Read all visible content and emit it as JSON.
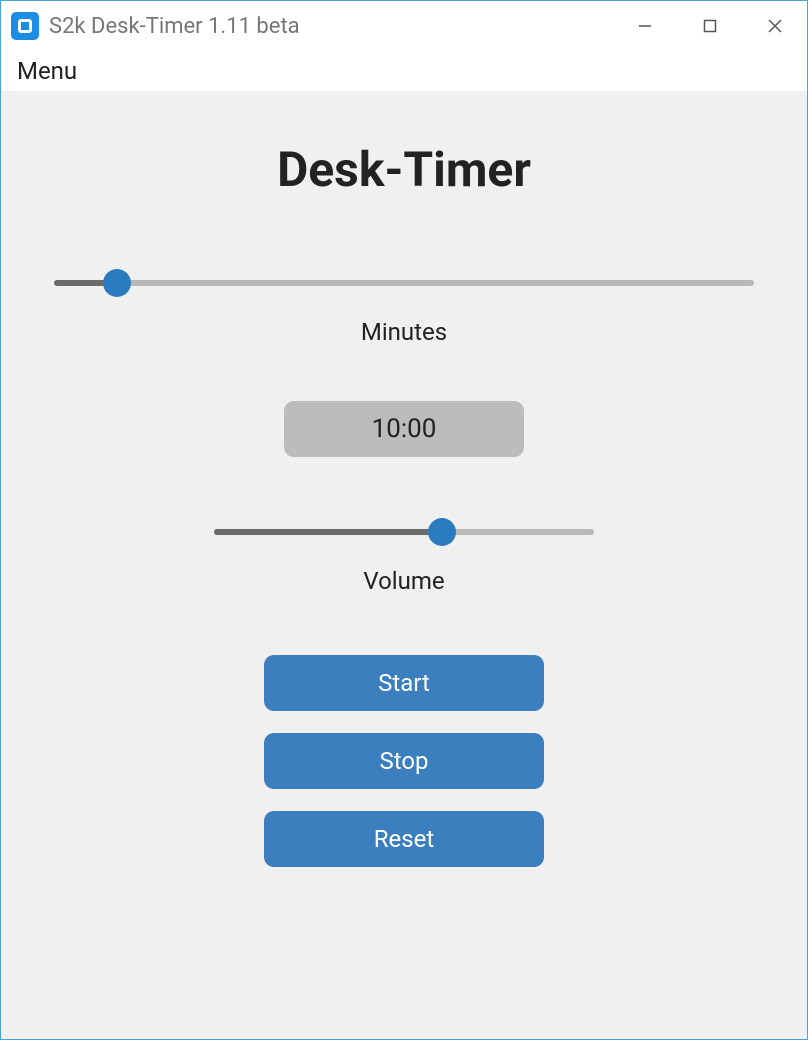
{
  "window": {
    "title": "S2k Desk-Timer 1.11 beta"
  },
  "menubar": {
    "menu_label": "Menu"
  },
  "main": {
    "heading": "Desk-Timer",
    "minutes_slider": {
      "label": "Minutes",
      "percent": 9
    },
    "time_display": "10:00",
    "volume_slider": {
      "label": "Volume",
      "percent": 60
    },
    "buttons": {
      "start": "Start",
      "stop": "Stop",
      "reset": "Reset"
    }
  },
  "colors": {
    "accent": "#3b7fbf",
    "thumb": "#2b7bbf",
    "content_bg": "#f0f0f0"
  }
}
